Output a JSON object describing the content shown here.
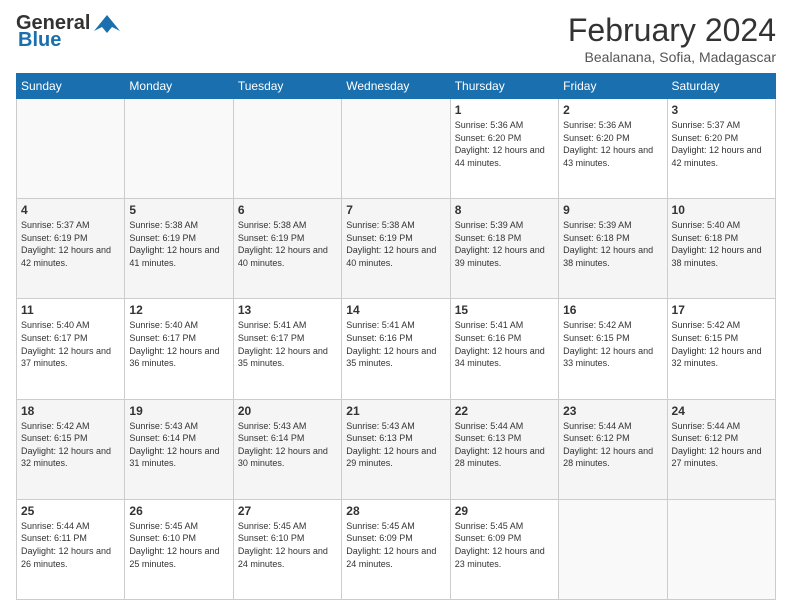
{
  "header": {
    "logo_general": "General",
    "logo_blue": "Blue",
    "title": "February 2024",
    "subtitle": "Bealanana, Sofia, Madagascar"
  },
  "days_of_week": [
    "Sunday",
    "Monday",
    "Tuesday",
    "Wednesday",
    "Thursday",
    "Friday",
    "Saturday"
  ],
  "weeks": [
    [
      {
        "day": "",
        "info": ""
      },
      {
        "day": "",
        "info": ""
      },
      {
        "day": "",
        "info": ""
      },
      {
        "day": "",
        "info": ""
      },
      {
        "day": "1",
        "info": "Sunrise: 5:36 AM\nSunset: 6:20 PM\nDaylight: 12 hours\nand 44 minutes."
      },
      {
        "day": "2",
        "info": "Sunrise: 5:36 AM\nSunset: 6:20 PM\nDaylight: 12 hours\nand 43 minutes."
      },
      {
        "day": "3",
        "info": "Sunrise: 5:37 AM\nSunset: 6:20 PM\nDaylight: 12 hours\nand 42 minutes."
      }
    ],
    [
      {
        "day": "4",
        "info": "Sunrise: 5:37 AM\nSunset: 6:19 PM\nDaylight: 12 hours\nand 42 minutes."
      },
      {
        "day": "5",
        "info": "Sunrise: 5:38 AM\nSunset: 6:19 PM\nDaylight: 12 hours\nand 41 minutes."
      },
      {
        "day": "6",
        "info": "Sunrise: 5:38 AM\nSunset: 6:19 PM\nDaylight: 12 hours\nand 40 minutes."
      },
      {
        "day": "7",
        "info": "Sunrise: 5:38 AM\nSunset: 6:19 PM\nDaylight: 12 hours\nand 40 minutes."
      },
      {
        "day": "8",
        "info": "Sunrise: 5:39 AM\nSunset: 6:18 PM\nDaylight: 12 hours\nand 39 minutes."
      },
      {
        "day": "9",
        "info": "Sunrise: 5:39 AM\nSunset: 6:18 PM\nDaylight: 12 hours\nand 38 minutes."
      },
      {
        "day": "10",
        "info": "Sunrise: 5:40 AM\nSunset: 6:18 PM\nDaylight: 12 hours\nand 38 minutes."
      }
    ],
    [
      {
        "day": "11",
        "info": "Sunrise: 5:40 AM\nSunset: 6:17 PM\nDaylight: 12 hours\nand 37 minutes."
      },
      {
        "day": "12",
        "info": "Sunrise: 5:40 AM\nSunset: 6:17 PM\nDaylight: 12 hours\nand 36 minutes."
      },
      {
        "day": "13",
        "info": "Sunrise: 5:41 AM\nSunset: 6:17 PM\nDaylight: 12 hours\nand 35 minutes."
      },
      {
        "day": "14",
        "info": "Sunrise: 5:41 AM\nSunset: 6:16 PM\nDaylight: 12 hours\nand 35 minutes."
      },
      {
        "day": "15",
        "info": "Sunrise: 5:41 AM\nSunset: 6:16 PM\nDaylight: 12 hours\nand 34 minutes."
      },
      {
        "day": "16",
        "info": "Sunrise: 5:42 AM\nSunset: 6:15 PM\nDaylight: 12 hours\nand 33 minutes."
      },
      {
        "day": "17",
        "info": "Sunrise: 5:42 AM\nSunset: 6:15 PM\nDaylight: 12 hours\nand 32 minutes."
      }
    ],
    [
      {
        "day": "18",
        "info": "Sunrise: 5:42 AM\nSunset: 6:15 PM\nDaylight: 12 hours\nand 32 minutes."
      },
      {
        "day": "19",
        "info": "Sunrise: 5:43 AM\nSunset: 6:14 PM\nDaylight: 12 hours\nand 31 minutes."
      },
      {
        "day": "20",
        "info": "Sunrise: 5:43 AM\nSunset: 6:14 PM\nDaylight: 12 hours\nand 30 minutes."
      },
      {
        "day": "21",
        "info": "Sunrise: 5:43 AM\nSunset: 6:13 PM\nDaylight: 12 hours\nand 29 minutes."
      },
      {
        "day": "22",
        "info": "Sunrise: 5:44 AM\nSunset: 6:13 PM\nDaylight: 12 hours\nand 28 minutes."
      },
      {
        "day": "23",
        "info": "Sunrise: 5:44 AM\nSunset: 6:12 PM\nDaylight: 12 hours\nand 28 minutes."
      },
      {
        "day": "24",
        "info": "Sunrise: 5:44 AM\nSunset: 6:12 PM\nDaylight: 12 hours\nand 27 minutes."
      }
    ],
    [
      {
        "day": "25",
        "info": "Sunrise: 5:44 AM\nSunset: 6:11 PM\nDaylight: 12 hours\nand 26 minutes."
      },
      {
        "day": "26",
        "info": "Sunrise: 5:45 AM\nSunset: 6:10 PM\nDaylight: 12 hours\nand 25 minutes."
      },
      {
        "day": "27",
        "info": "Sunrise: 5:45 AM\nSunset: 6:10 PM\nDaylight: 12 hours\nand 24 minutes."
      },
      {
        "day": "28",
        "info": "Sunrise: 5:45 AM\nSunset: 6:09 PM\nDaylight: 12 hours\nand 24 minutes."
      },
      {
        "day": "29",
        "info": "Sunrise: 5:45 AM\nSunset: 6:09 PM\nDaylight: 12 hours\nand 23 minutes."
      },
      {
        "day": "",
        "info": ""
      },
      {
        "day": "",
        "info": ""
      }
    ]
  ]
}
